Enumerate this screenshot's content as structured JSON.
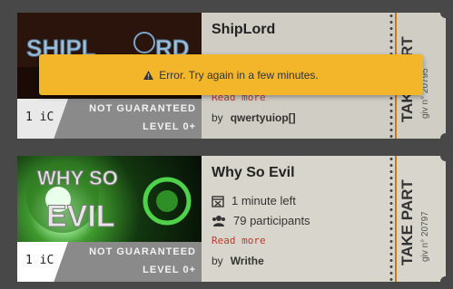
{
  "toast": {
    "message": "Error. Try again in a few minutes.",
    "icon": "warning-icon"
  },
  "giveaways": [
    {
      "banner_text": "SHIPLORD",
      "price": "1 iC",
      "guarantee": "NOT GUARANTEED",
      "level": "LEVEL 0+",
      "title": "ShipLord",
      "read_more": "Read more",
      "by_label": "by",
      "author": "qwertyuiop[]",
      "take_part": "TAKE PART",
      "giv_number": "giv n° 20795"
    },
    {
      "banner_text": "WHY SO EVIL",
      "price": "1 iC",
      "guarantee": "NOT GUARANTEED",
      "level": "LEVEL 0+",
      "title": "Why So Evil",
      "time_left": "1 minute left",
      "participants": "79 participants",
      "read_more": "Read more",
      "by_label": "by",
      "author": "Writhe",
      "take_part": "TAKE PART",
      "giv_number": "giv n° 20797"
    }
  ],
  "colors": {
    "toast_bg": "#f3b52a",
    "read_more": "#c0392b",
    "ticket_accent": "#c57a1e"
  }
}
